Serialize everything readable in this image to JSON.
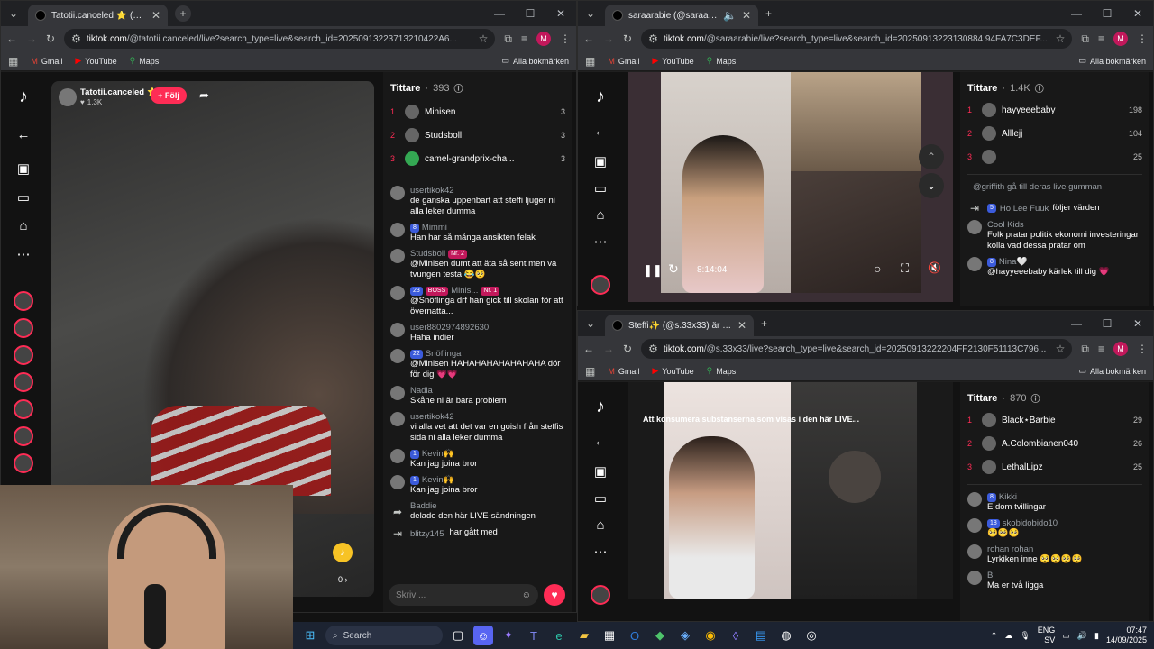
{
  "left_window": {
    "tab_title": "Tatotii.canceled ⭐ (@tatotii.ca",
    "url_host": "tiktok.com",
    "url_rest": "/@tatotii.canceled/live?search_type=live&search_id=20250913223713210422A6...",
    "profile_initial": "M",
    "bookmarks": [
      "Gmail",
      "YouTube",
      "Maps"
    ],
    "all_bookmarks": "Alla bokmärken",
    "streamer": {
      "name": "Tatotii.canceled",
      "likes": "1.3K",
      "follow": "+ Följ"
    },
    "viewers_title": "Tittare",
    "viewers_count": "393",
    "viewers": [
      {
        "rank": "1",
        "name": "Minisen",
        "score": "3"
      },
      {
        "rank": "2",
        "name": "Studsboll",
        "score": "3"
      },
      {
        "rank": "3",
        "name": "camel-grandprix-cha...",
        "score": "3"
      }
    ],
    "messages": [
      {
        "user": "usertikok42",
        "badges": [],
        "text": "de ganska uppenbart att steffi ljuger ni alla leker dumma"
      },
      {
        "user": "Mimmi",
        "badges": [
          "8"
        ],
        "text": "Han har så många ansikten felak"
      },
      {
        "user": "Studsboll",
        "badges": [
          "Nr. 2"
        ],
        "text": "@Minisen dumt att äta så sent men va tvungen testa 😂🥺"
      },
      {
        "user": "Minis...",
        "badges": [
          "23",
          "BOSS",
          "Nr. 1"
        ],
        "text": "@Snöflinga drf han gick till skolan för att övernatta..."
      },
      {
        "user": "user8802974892630",
        "badges": [],
        "text": "Haha indier"
      },
      {
        "user": "Snöflinga",
        "badges": [
          "22"
        ],
        "text": "@Minisen HAHAHAHAHAHAHAHA dör för dig 💗💗"
      },
      {
        "user": "Nadia",
        "badges": [],
        "text": "Skåne ni är bara problem"
      },
      {
        "user": "usertikok42",
        "badges": [],
        "text": "vi alla vet att det var en goish från steffis sida ni alla leker dumma"
      },
      {
        "user": "Kevin🙌",
        "badges": [
          "1"
        ],
        "text": "Kan jag joina bror"
      },
      {
        "user": "Kevin🙌",
        "badges": [
          "1"
        ],
        "text": "Kan jag joina bror"
      },
      {
        "user": "Baddie",
        "badges": [],
        "text": "delade den här LIVE-sändningen"
      },
      {
        "user": "blitzy145",
        "badges": [],
        "text": "har gått med"
      }
    ],
    "comment_placeholder": "Skriv ...",
    "gift_count": "0 ›"
  },
  "top_right_window": {
    "tab_title": "saraarabie (@saraarabie) är",
    "url_host": "tiktok.com",
    "url_rest": "/@saraarabie/live?search_type=live&search_id=20250913223130884 94FA7C3DEF...",
    "profile_initial": "M",
    "bookmarks": [
      "Gmail",
      "YouTube",
      "Maps"
    ],
    "all_bookmarks": "Alla bokmärken",
    "video_time": "8:14:04",
    "viewers_title": "Tittare",
    "viewers_count": "1.4K",
    "viewers": [
      {
        "rank": "1",
        "name": "hayyeeebaby",
        "score": "198"
      },
      {
        "rank": "2",
        "name": "Alllejj",
        "score": "104"
      },
      {
        "rank": "3",
        "name": "",
        "score": "25"
      }
    ],
    "messages": [
      {
        "user": "",
        "badges": [],
        "text": "@griffith gå till deras live gumman"
      },
      {
        "user": "Ho Lee Fuuk",
        "badges": [
          "5"
        ],
        "text": "följer värden"
      },
      {
        "user": "Cool Kids",
        "badges": [],
        "text": "Folk pratar politik ekonomi investeringar kolla vad dessa pratar om"
      },
      {
        "user": "Nina🤍",
        "badges": [
          "8"
        ],
        "text": "@hayyeeebaby kärlek till dig 💗"
      }
    ]
  },
  "bottom_right_window": {
    "tab_title": "Steffi✨ (@s.33x33) är LIVE – Ti",
    "url_host": "tiktok.com",
    "url_rest": "/@s.33x33/live?search_type=live&search_id=20250913222204FF2130F51113C796...",
    "profile_initial": "M",
    "bookmarks": [
      "Gmail",
      "YouTube",
      "Maps"
    ],
    "all_bookmarks": "Alla bokmärken",
    "video_banner": "Att konsumera substanserna som visas i den här LIVE...",
    "viewers_title": "Tittare",
    "viewers_count": "870",
    "viewers": [
      {
        "rank": "1",
        "name": "Black⋆Barbie",
        "score": "29"
      },
      {
        "rank": "2",
        "name": "A.Colombianen040",
        "score": "26"
      },
      {
        "rank": "3",
        "name": "LethalLipz",
        "score": "25"
      }
    ],
    "messages": [
      {
        "user": "Kikki",
        "badges": [
          "8"
        ],
        "text": "E dom tvillingar"
      },
      {
        "user": "skobidobido10",
        "badges": [
          "18"
        ],
        "text": "🥺🥺🥺"
      },
      {
        "user": "rohan rohan",
        "badges": [],
        "text": "Lyrkiken inne 🥺🥺🥺🥺"
      },
      {
        "user": "B",
        "badges": [],
        "text": "Ma er två ligga"
      }
    ]
  },
  "taskbar": {
    "search_label": "Search",
    "lang": "ENG",
    "region": "SV",
    "time": "07:47",
    "date": "14/09/2025"
  },
  "colors": {
    "tiktok_red": "#fe2c55",
    "chrome_bg": "#202124",
    "chrome_toolbar": "#35363a"
  }
}
